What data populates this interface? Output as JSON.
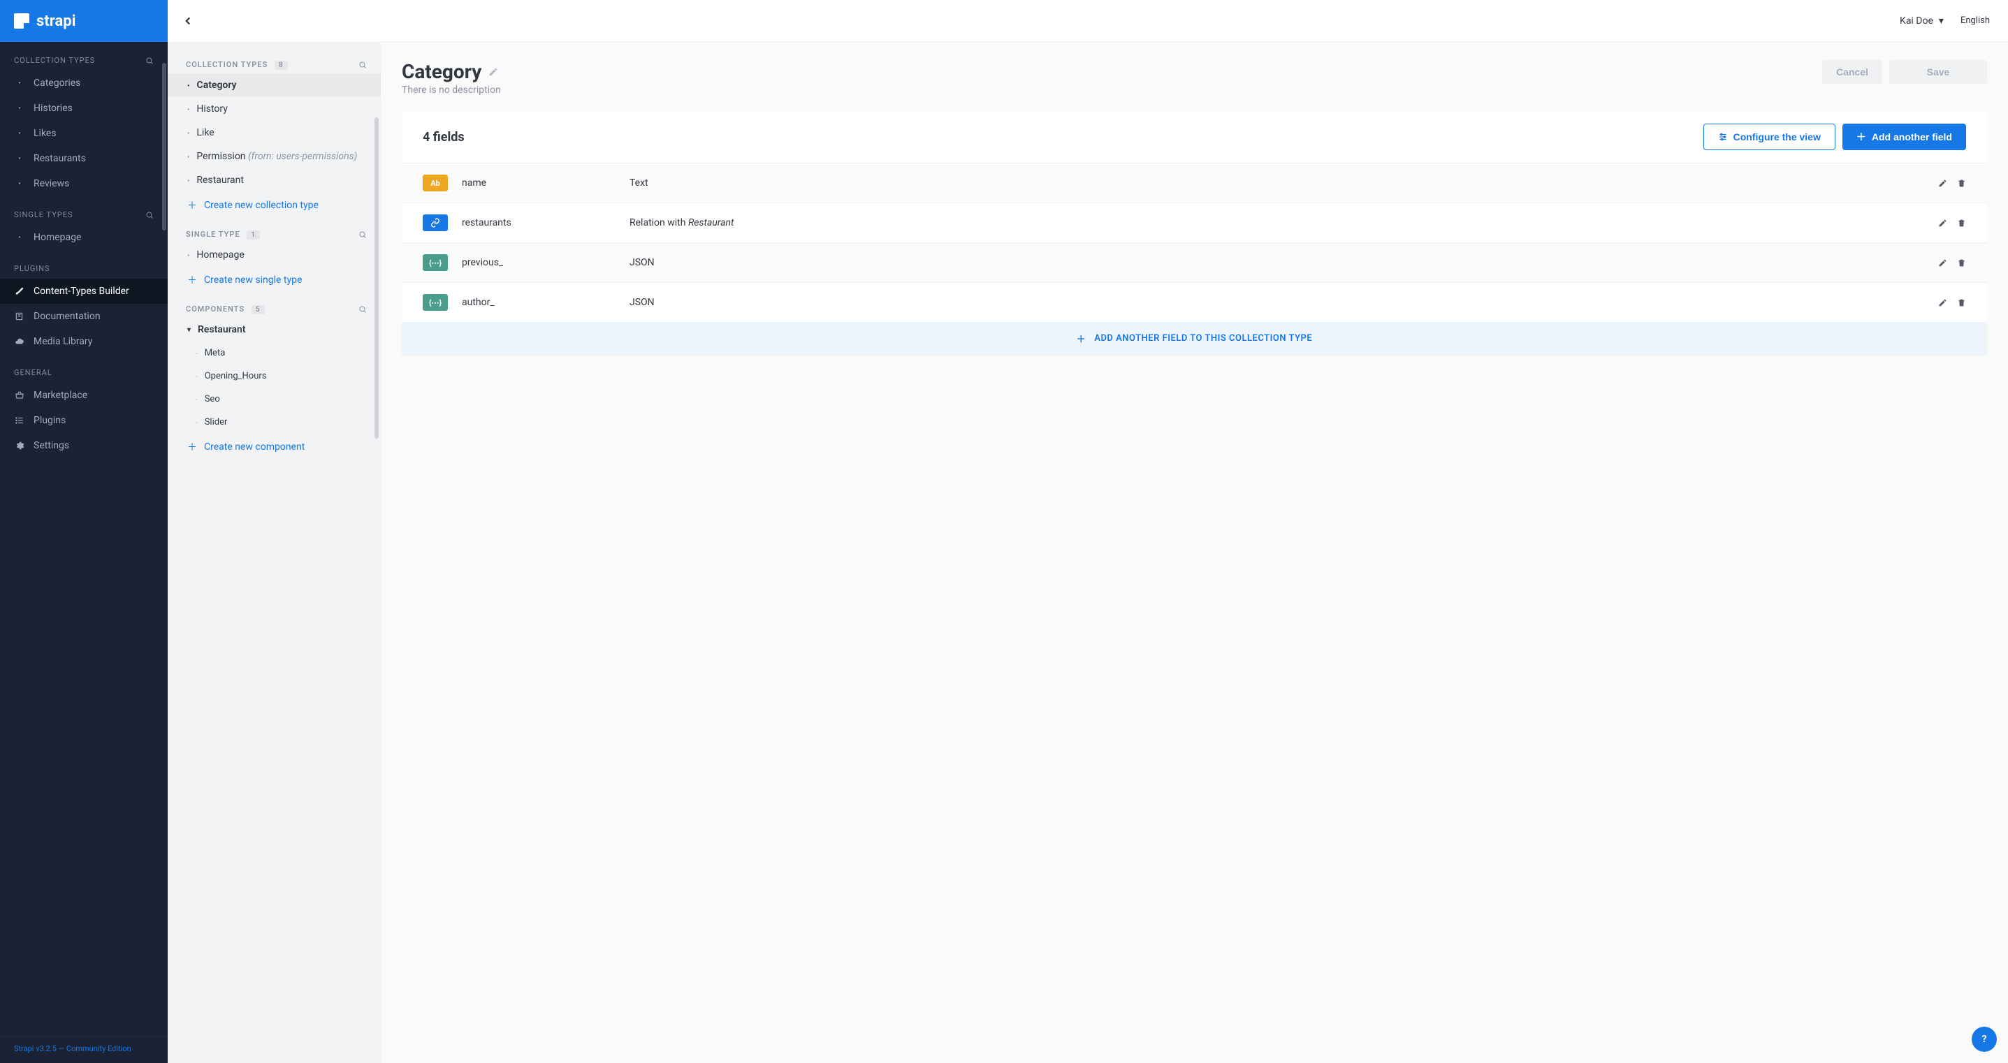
{
  "brand": "strapi",
  "user": {
    "name": "Kai Doe",
    "language": "English"
  },
  "footer": "Strapi v3.2.5 — Community Edition",
  "sidebar": {
    "sections": [
      {
        "title": "COLLECTION TYPES",
        "searchable": true,
        "items": [
          "Categories",
          "Histories",
          "Likes",
          "Restaurants",
          "Reviews"
        ]
      },
      {
        "title": "SINGLE TYPES",
        "searchable": true,
        "items": [
          "Homepage"
        ]
      },
      {
        "title": "PLUGINS",
        "items": [
          "Content-Types Builder",
          "Documentation",
          "Media Library"
        ],
        "activeIndex": 0
      },
      {
        "title": "GENERAL",
        "items": [
          "Marketplace",
          "Plugins",
          "Settings"
        ]
      }
    ]
  },
  "panel": {
    "groups": [
      {
        "title": "COLLECTION TYPES",
        "count": 8,
        "items": [
          {
            "label": "Category",
            "active": true
          },
          {
            "label": "History"
          },
          {
            "label": "Like"
          },
          {
            "label": "Permission",
            "hint": "(from: users-permissions)"
          },
          {
            "label": "Restaurant"
          }
        ],
        "action": "Create new collection type"
      },
      {
        "title": "SINGLE TYPE",
        "count": 1,
        "items": [
          {
            "label": "Homepage"
          }
        ],
        "action": "Create new single type"
      },
      {
        "title": "COMPONENTS",
        "count": 5,
        "expandable": [
          {
            "label": "Restaurant",
            "children": [
              "Meta",
              "Opening_Hours",
              "Seo",
              "Slider"
            ]
          }
        ],
        "action": "Create new component"
      }
    ]
  },
  "page": {
    "title": "Category",
    "subtitle": "There is no description",
    "buttons": {
      "cancel": "Cancel",
      "save": "Save"
    },
    "fieldsHeader": "4 fields",
    "configureView": "Configure the view",
    "addField": "Add another field",
    "addFieldRow": "ADD ANOTHER FIELD TO THIS COLLECTION TYPE",
    "fields": [
      {
        "icon": "text",
        "name": "name",
        "type": "Text"
      },
      {
        "icon": "relation",
        "name": "restaurants",
        "type": "Relation with ",
        "typeItalic": "Restaurant"
      },
      {
        "icon": "json",
        "name": "previous_",
        "type": "JSON"
      },
      {
        "icon": "json",
        "name": "author_",
        "type": "JSON"
      }
    ]
  }
}
